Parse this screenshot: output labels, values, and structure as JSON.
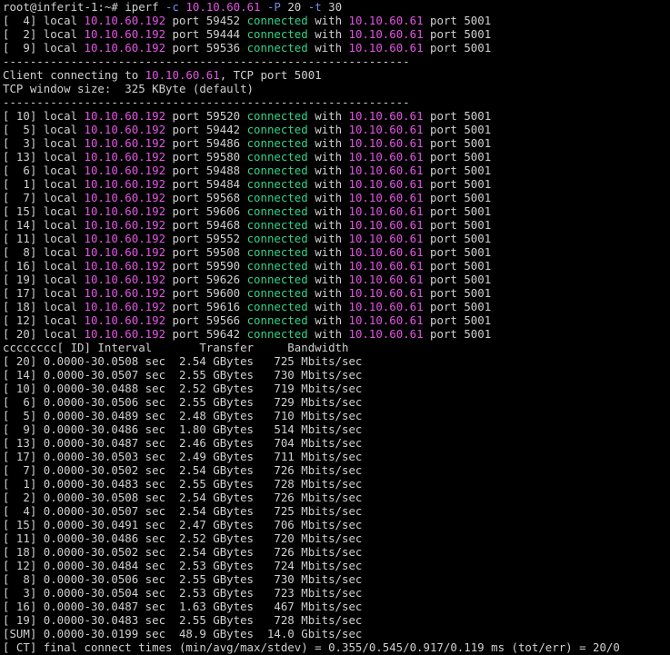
{
  "colors": {
    "background": "#000000",
    "text": "#d0d0d0",
    "ip": "#e454e4",
    "flag": "#7a8ce8",
    "connected": "#2fd38a"
  },
  "lines": [
    [
      {
        "t": "root@inferit-1:~# iperf ",
        "c": "plain"
      },
      {
        "t": "-c",
        "c": "flag"
      },
      {
        "t": " ",
        "c": "plain"
      },
      {
        "t": "10.10.60.61",
        "c": "ip"
      },
      {
        "t": " ",
        "c": "plain"
      },
      {
        "t": "-P",
        "c": "flag"
      },
      {
        "t": " 20 ",
        "c": "plain"
      },
      {
        "t": "-t",
        "c": "flag"
      },
      {
        "t": " 30",
        "c": "plain"
      }
    ],
    [
      {
        "t": "[  4] local ",
        "c": "plain"
      },
      {
        "t": "10.10.60.192",
        "c": "ip"
      },
      {
        "t": " port 59452 ",
        "c": "plain"
      },
      {
        "t": "connected",
        "c": "ok"
      },
      {
        "t": " with ",
        "c": "plain"
      },
      {
        "t": "10.10.60.61",
        "c": "ip"
      },
      {
        "t": " port 5001",
        "c": "plain"
      }
    ],
    [
      {
        "t": "[  2] local ",
        "c": "plain"
      },
      {
        "t": "10.10.60.192",
        "c": "ip"
      },
      {
        "t": " port 59444 ",
        "c": "plain"
      },
      {
        "t": "connected",
        "c": "ok"
      },
      {
        "t": " with ",
        "c": "plain"
      },
      {
        "t": "10.10.60.61",
        "c": "ip"
      },
      {
        "t": " port 5001",
        "c": "plain"
      }
    ],
    [
      {
        "t": "[  9] local ",
        "c": "plain"
      },
      {
        "t": "10.10.60.192",
        "c": "ip"
      },
      {
        "t": " port 59536 ",
        "c": "plain"
      },
      {
        "t": "connected",
        "c": "ok"
      },
      {
        "t": " with ",
        "c": "plain"
      },
      {
        "t": "10.10.60.61",
        "c": "ip"
      },
      {
        "t": " port 5001",
        "c": "plain"
      }
    ],
    [
      {
        "t": "------------------------------------------------------------",
        "c": "plain"
      }
    ],
    [
      {
        "t": "Client connecting to ",
        "c": "plain"
      },
      {
        "t": "10.10.60.61",
        "c": "ip"
      },
      {
        "t": ", TCP port 5001",
        "c": "plain"
      }
    ],
    [
      {
        "t": "TCP window size:  325 KByte (default)",
        "c": "plain"
      }
    ],
    [
      {
        "t": "------------------------------------------------------------",
        "c": "plain"
      }
    ],
    [
      {
        "t": "[ 10] local ",
        "c": "plain"
      },
      {
        "t": "10.10.60.192",
        "c": "ip"
      },
      {
        "t": " port 59520 ",
        "c": "plain"
      },
      {
        "t": "connected",
        "c": "ok"
      },
      {
        "t": " with ",
        "c": "plain"
      },
      {
        "t": "10.10.60.61",
        "c": "ip"
      },
      {
        "t": " port 5001",
        "c": "plain"
      }
    ],
    [
      {
        "t": "[  5] local ",
        "c": "plain"
      },
      {
        "t": "10.10.60.192",
        "c": "ip"
      },
      {
        "t": " port 59442 ",
        "c": "plain"
      },
      {
        "t": "connected",
        "c": "ok"
      },
      {
        "t": " with ",
        "c": "plain"
      },
      {
        "t": "10.10.60.61",
        "c": "ip"
      },
      {
        "t": " port 5001",
        "c": "plain"
      }
    ],
    [
      {
        "t": "[  3] local ",
        "c": "plain"
      },
      {
        "t": "10.10.60.192",
        "c": "ip"
      },
      {
        "t": " port 59486 ",
        "c": "plain"
      },
      {
        "t": "connected",
        "c": "ok"
      },
      {
        "t": " with ",
        "c": "plain"
      },
      {
        "t": "10.10.60.61",
        "c": "ip"
      },
      {
        "t": " port 5001",
        "c": "plain"
      }
    ],
    [
      {
        "t": "[ 13] local ",
        "c": "plain"
      },
      {
        "t": "10.10.60.192",
        "c": "ip"
      },
      {
        "t": " port 59580 ",
        "c": "plain"
      },
      {
        "t": "connected",
        "c": "ok"
      },
      {
        "t": " with ",
        "c": "plain"
      },
      {
        "t": "10.10.60.61",
        "c": "ip"
      },
      {
        "t": " port 5001",
        "c": "plain"
      }
    ],
    [
      {
        "t": "[  6] local ",
        "c": "plain"
      },
      {
        "t": "10.10.60.192",
        "c": "ip"
      },
      {
        "t": " port 59488 ",
        "c": "plain"
      },
      {
        "t": "connected",
        "c": "ok"
      },
      {
        "t": " with ",
        "c": "plain"
      },
      {
        "t": "10.10.60.61",
        "c": "ip"
      },
      {
        "t": " port 5001",
        "c": "plain"
      }
    ],
    [
      {
        "t": "[  1] local ",
        "c": "plain"
      },
      {
        "t": "10.10.60.192",
        "c": "ip"
      },
      {
        "t": " port 59484 ",
        "c": "plain"
      },
      {
        "t": "connected",
        "c": "ok"
      },
      {
        "t": " with ",
        "c": "plain"
      },
      {
        "t": "10.10.60.61",
        "c": "ip"
      },
      {
        "t": " port 5001",
        "c": "plain"
      }
    ],
    [
      {
        "t": "[  7] local ",
        "c": "plain"
      },
      {
        "t": "10.10.60.192",
        "c": "ip"
      },
      {
        "t": " port 59568 ",
        "c": "plain"
      },
      {
        "t": "connected",
        "c": "ok"
      },
      {
        "t": " with ",
        "c": "plain"
      },
      {
        "t": "10.10.60.61",
        "c": "ip"
      },
      {
        "t": " port 5001",
        "c": "plain"
      }
    ],
    [
      {
        "t": "[ 15] local ",
        "c": "plain"
      },
      {
        "t": "10.10.60.192",
        "c": "ip"
      },
      {
        "t": " port 59606 ",
        "c": "plain"
      },
      {
        "t": "connected",
        "c": "ok"
      },
      {
        "t": " with ",
        "c": "plain"
      },
      {
        "t": "10.10.60.61",
        "c": "ip"
      },
      {
        "t": " port 5001",
        "c": "plain"
      }
    ],
    [
      {
        "t": "[ 14] local ",
        "c": "plain"
      },
      {
        "t": "10.10.60.192",
        "c": "ip"
      },
      {
        "t": " port 59468 ",
        "c": "plain"
      },
      {
        "t": "connected",
        "c": "ok"
      },
      {
        "t": " with ",
        "c": "plain"
      },
      {
        "t": "10.10.60.61",
        "c": "ip"
      },
      {
        "t": " port 5001",
        "c": "plain"
      }
    ],
    [
      {
        "t": "[ 11] local ",
        "c": "plain"
      },
      {
        "t": "10.10.60.192",
        "c": "ip"
      },
      {
        "t": " port 59552 ",
        "c": "plain"
      },
      {
        "t": "connected",
        "c": "ok"
      },
      {
        "t": " with ",
        "c": "plain"
      },
      {
        "t": "10.10.60.61",
        "c": "ip"
      },
      {
        "t": " port 5001",
        "c": "plain"
      }
    ],
    [
      {
        "t": "[  8] local ",
        "c": "plain"
      },
      {
        "t": "10.10.60.192",
        "c": "ip"
      },
      {
        "t": " port 59508 ",
        "c": "plain"
      },
      {
        "t": "connected",
        "c": "ok"
      },
      {
        "t": " with ",
        "c": "plain"
      },
      {
        "t": "10.10.60.61",
        "c": "ip"
      },
      {
        "t": " port 5001",
        "c": "plain"
      }
    ],
    [
      {
        "t": "[ 16] local ",
        "c": "plain"
      },
      {
        "t": "10.10.60.192",
        "c": "ip"
      },
      {
        "t": " port 59590 ",
        "c": "plain"
      },
      {
        "t": "connected",
        "c": "ok"
      },
      {
        "t": " with ",
        "c": "plain"
      },
      {
        "t": "10.10.60.61",
        "c": "ip"
      },
      {
        "t": " port 5001",
        "c": "plain"
      }
    ],
    [
      {
        "t": "[ 19] local ",
        "c": "plain"
      },
      {
        "t": "10.10.60.192",
        "c": "ip"
      },
      {
        "t": " port 59626 ",
        "c": "plain"
      },
      {
        "t": "connected",
        "c": "ok"
      },
      {
        "t": " with ",
        "c": "plain"
      },
      {
        "t": "10.10.60.61",
        "c": "ip"
      },
      {
        "t": " port 5001",
        "c": "plain"
      }
    ],
    [
      {
        "t": "[ 17] local ",
        "c": "plain"
      },
      {
        "t": "10.10.60.192",
        "c": "ip"
      },
      {
        "t": " port 59600 ",
        "c": "plain"
      },
      {
        "t": "connected",
        "c": "ok"
      },
      {
        "t": " with ",
        "c": "plain"
      },
      {
        "t": "10.10.60.61",
        "c": "ip"
      },
      {
        "t": " port 5001",
        "c": "plain"
      }
    ],
    [
      {
        "t": "[ 18] local ",
        "c": "plain"
      },
      {
        "t": "10.10.60.192",
        "c": "ip"
      },
      {
        "t": " port 59616 ",
        "c": "plain"
      },
      {
        "t": "connected",
        "c": "ok"
      },
      {
        "t": " with ",
        "c": "plain"
      },
      {
        "t": "10.10.60.61",
        "c": "ip"
      },
      {
        "t": " port 5001",
        "c": "plain"
      }
    ],
    [
      {
        "t": "[ 12] local ",
        "c": "plain"
      },
      {
        "t": "10.10.60.192",
        "c": "ip"
      },
      {
        "t": " port 59566 ",
        "c": "plain"
      },
      {
        "t": "connected",
        "c": "ok"
      },
      {
        "t": " with ",
        "c": "plain"
      },
      {
        "t": "10.10.60.61",
        "c": "ip"
      },
      {
        "t": " port 5001",
        "c": "plain"
      }
    ],
    [
      {
        "t": "[ 20] local ",
        "c": "plain"
      },
      {
        "t": "10.10.60.192",
        "c": "ip"
      },
      {
        "t": " port 59642 ",
        "c": "plain"
      },
      {
        "t": "connected",
        "c": "ok"
      },
      {
        "t": " with ",
        "c": "plain"
      },
      {
        "t": "10.10.60.61",
        "c": "ip"
      },
      {
        "t": " port 5001",
        "c": "plain"
      }
    ],
    [
      {
        "t": "cccccccc[ ID] Interval       Transfer     Bandwidth",
        "c": "plain"
      }
    ],
    [
      {
        "t": "[ 20] 0.0000-30.0508 sec  2.54 GBytes   725 Mbits/sec",
        "c": "plain"
      }
    ],
    [
      {
        "t": "[ 14] 0.0000-30.0507 sec  2.55 GBytes   730 Mbits/sec",
        "c": "plain"
      }
    ],
    [
      {
        "t": "[ 10] 0.0000-30.0488 sec  2.52 GBytes   719 Mbits/sec",
        "c": "plain"
      }
    ],
    [
      {
        "t": "[  6] 0.0000-30.0506 sec  2.55 GBytes   729 Mbits/sec",
        "c": "plain"
      }
    ],
    [
      {
        "t": "[  5] 0.0000-30.0489 sec  2.48 GBytes   710 Mbits/sec",
        "c": "plain"
      }
    ],
    [
      {
        "t": "[  9] 0.0000-30.0486 sec  1.80 GBytes   514 Mbits/sec",
        "c": "plain"
      }
    ],
    [
      {
        "t": "[ 13] 0.0000-30.0487 sec  2.46 GBytes   704 Mbits/sec",
        "c": "plain"
      }
    ],
    [
      {
        "t": "[ 17] 0.0000-30.0503 sec  2.49 GBytes   711 Mbits/sec",
        "c": "plain"
      }
    ],
    [
      {
        "t": "[  7] 0.0000-30.0502 sec  2.54 GBytes   726 Mbits/sec",
        "c": "plain"
      }
    ],
    [
      {
        "t": "[  1] 0.0000-30.0483 sec  2.55 GBytes   728 Mbits/sec",
        "c": "plain"
      }
    ],
    [
      {
        "t": "[  2] 0.0000-30.0508 sec  2.54 GBytes   726 Mbits/sec",
        "c": "plain"
      }
    ],
    [
      {
        "t": "[  4] 0.0000-30.0507 sec  2.54 GBytes   725 Mbits/sec",
        "c": "plain"
      }
    ],
    [
      {
        "t": "[ 15] 0.0000-30.0491 sec  2.47 GBytes   706 Mbits/sec",
        "c": "plain"
      }
    ],
    [
      {
        "t": "[ 11] 0.0000-30.0486 sec  2.52 GBytes   720 Mbits/sec",
        "c": "plain"
      }
    ],
    [
      {
        "t": "[ 18] 0.0000-30.0502 sec  2.54 GBytes   726 Mbits/sec",
        "c": "plain"
      }
    ],
    [
      {
        "t": "[ 12] 0.0000-30.0484 sec  2.53 GBytes   724 Mbits/sec",
        "c": "plain"
      }
    ],
    [
      {
        "t": "[  8] 0.0000-30.0506 sec  2.55 GBytes   730 Mbits/sec",
        "c": "plain"
      }
    ],
    [
      {
        "t": "[  3] 0.0000-30.0504 sec  2.53 GBytes   723 Mbits/sec",
        "c": "plain"
      }
    ],
    [
      {
        "t": "[ 16] 0.0000-30.0487 sec  1.63 GBytes   467 Mbits/sec",
        "c": "plain"
      }
    ],
    [
      {
        "t": "[ 19] 0.0000-30.0483 sec  2.55 GBytes   728 Mbits/sec",
        "c": "plain"
      }
    ],
    [
      {
        "t": "[SUM] 0.0000-30.0199 sec  48.9 GBytes  14.0 Gbits/sec",
        "c": "plain"
      }
    ],
    [
      {
        "t": "[ CT] final connect times (min/avg/max/stdev) = 0.355/0.545/0.917/0.119 ms (tot/err) = 20/0",
        "c": "plain"
      }
    ]
  ]
}
